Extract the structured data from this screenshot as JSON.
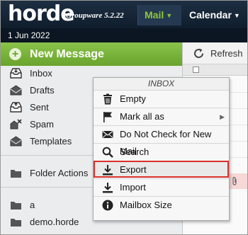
{
  "header": {
    "logo": "horde",
    "version": "Groupware 5.2.22",
    "tabs": [
      {
        "label": "Mail"
      },
      {
        "label": "Calendar"
      }
    ]
  },
  "datebar": {
    "date": "1 Jun 2022"
  },
  "sidebar": {
    "new_message": "New Message",
    "folders": [
      {
        "label": "Inbox",
        "icon": "inbox-icon"
      },
      {
        "label": "Drafts",
        "icon": "drafts-icon"
      },
      {
        "label": "Sent",
        "icon": "sent-icon"
      },
      {
        "label": "Spam",
        "icon": "spam-icon"
      },
      {
        "label": "Templates",
        "icon": "templates-icon"
      }
    ],
    "folder_actions": "Folder Actions",
    "user_folders": [
      {
        "label": "a",
        "icon": "folder-icon"
      },
      {
        "label": "demo.horde",
        "icon": "folder-icon"
      }
    ]
  },
  "rightpane": {
    "refresh": "Refresh"
  },
  "context_menu": {
    "title": "INBOX",
    "items": [
      {
        "label": "Empty",
        "icon": "trash-icon"
      },
      {
        "label": "Mark all as",
        "icon": "flag-icon",
        "has_submenu": true
      },
      {
        "label": "Do Not Check for New Mail",
        "icon": "envelope-icon"
      },
      {
        "label": "Search",
        "icon": "search-icon"
      },
      {
        "label": "Export",
        "icon": "download-icon",
        "highlighted": true
      },
      {
        "label": "Import",
        "icon": "import-icon"
      },
      {
        "label": "Mailbox Size",
        "icon": "info-icon"
      }
    ]
  },
  "colors": {
    "accent_green": "#8bc34a",
    "header_navy": "#13233a",
    "highlight_red": "#d9302c"
  }
}
